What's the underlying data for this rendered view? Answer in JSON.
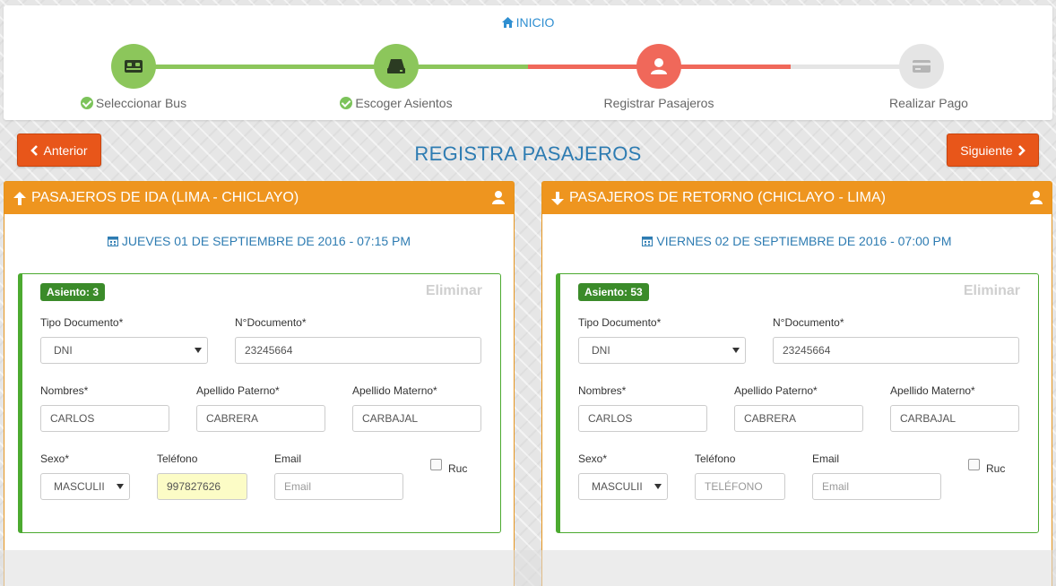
{
  "header": {
    "home_label": "INICIO"
  },
  "steps": [
    {
      "label": "Seleccionar Bus",
      "status": "done",
      "icon": "bed-icon"
    },
    {
      "label": "Escoger Asientos",
      "status": "done",
      "icon": "seat-icon"
    },
    {
      "label": "Registrar Pasajeros",
      "status": "current",
      "icon": "user-icon"
    },
    {
      "label": "Realizar Pago",
      "status": "pending",
      "icon": "credit-card-icon"
    }
  ],
  "actions": {
    "prev_label": "Anterior",
    "next_label": "Siguiente"
  },
  "page_title": "REGISTRA PASAJEROS",
  "colors": {
    "done": "#8cc65b",
    "current": "#f0685a",
    "pending": "#e5e5e5",
    "accent": "#ee951f",
    "button": "#e8561a",
    "title": "#2e7cb2"
  },
  "panels": [
    {
      "title": "PASAJEROS DE IDA (LIMA - CHICLAYO)",
      "direction": "up",
      "date": "JUEVES 01 DE SEPTIEMBRE DE 2016 - 07:15 PM",
      "passenger": {
        "seat": "Asiento: 3",
        "delete_label": "Eliminar",
        "labels": {
          "doc_type": "Tipo Documento*",
          "doc_number": "N°Documento*",
          "names": "Nombres*",
          "paternal": "Apellido Paterno*",
          "maternal": "Apellido Materno*",
          "sex": "Sexo*",
          "phone": "Teléfono",
          "email": "Email",
          "ruc": "Ruc"
        },
        "doc_type": "DNI",
        "doc_number": "23245664",
        "names": "CARLOS",
        "paternal": "CABRERA",
        "maternal": "CARBAJAL",
        "sex": "MASCULII",
        "phone": "997827626",
        "email_placeholder": "Email"
      }
    },
    {
      "title": "PASAJEROS DE RETORNO (CHICLAYO - LIMA)",
      "direction": "down",
      "date": "VIERNES 02 DE SEPTIEMBRE DE 2016 - 07:00 PM",
      "passenger": {
        "seat": "Asiento: 53",
        "delete_label": "Eliminar",
        "labels": {
          "doc_type": "Tipo Documento*",
          "doc_number": "N°Documento*",
          "names": "Nombres*",
          "paternal": "Apellido Paterno*",
          "maternal": "Apellido Materno*",
          "sex": "Sexo*",
          "phone": "Teléfono",
          "email": "Email",
          "ruc": "Ruc"
        },
        "doc_type": "DNI",
        "doc_number": "23245664",
        "names": "CARLOS",
        "paternal": "CABRERA",
        "maternal": "CARBAJAL",
        "sex": "MASCULII",
        "phone_placeholder": "TELÉFONO",
        "email_placeholder": "Email"
      }
    }
  ]
}
